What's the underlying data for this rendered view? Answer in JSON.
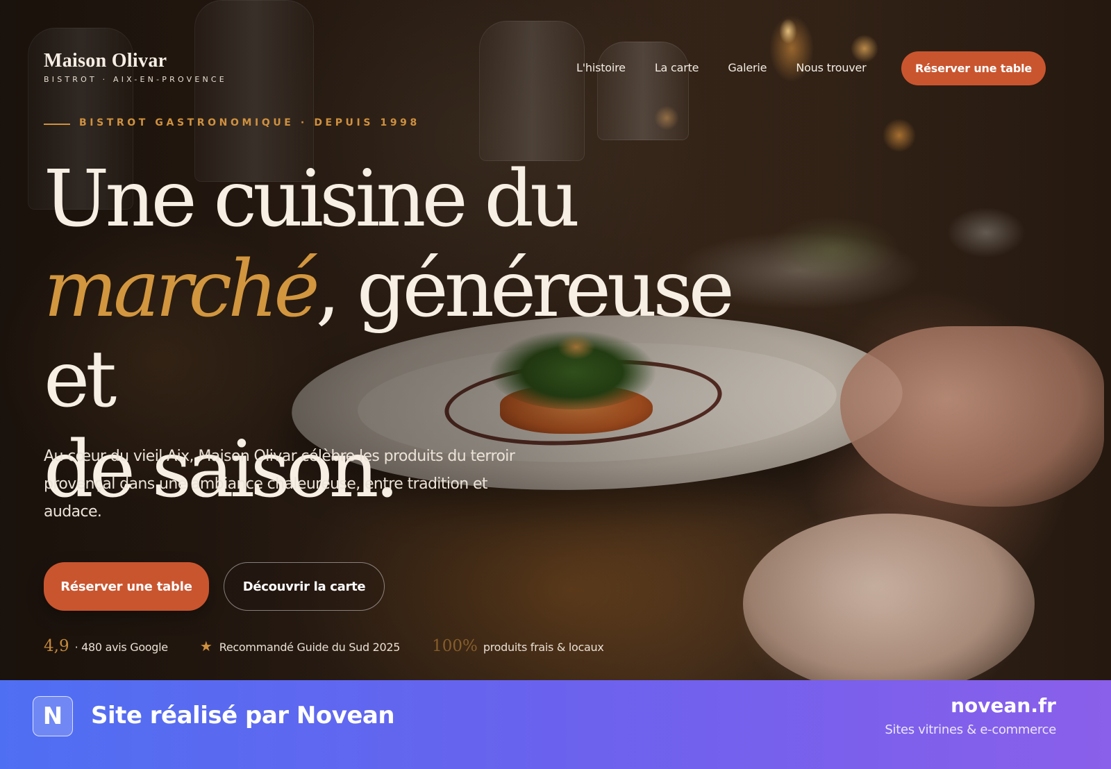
{
  "brand": {
    "name": "Maison Olivar",
    "tagline": "BISTROT · AIX-EN-PROVENCE"
  },
  "nav": {
    "items": [
      {
        "label": "L'histoire"
      },
      {
        "label": "La carte"
      },
      {
        "label": "Galerie"
      },
      {
        "label": "Nous trouver"
      }
    ],
    "cta_label": "Réserver une table"
  },
  "hero": {
    "eyebrow": "BISTROT GASTRONOMIQUE · DEPUIS 1998",
    "headline": {
      "part1": "Une cuisine du",
      "accent": "marché",
      "part2": ", généreuse et",
      "part3": "de saison."
    },
    "lede": "Au cœur du vieil Aix, Maison Olivar célèbre les produits du terroir provençal dans une ambiance chaleureuse, entre tradition et audace.",
    "primary_cta": "Réserver une table",
    "secondary_cta": "Découvrir la carte",
    "stats": [
      {
        "value": "4,9",
        "text": "· 480 avis Google"
      },
      {
        "icon": "star-icon",
        "text": "Recommandé Guide du Sud 2025"
      },
      {
        "value": "100%",
        "text": "produits frais & locaux"
      }
    ]
  },
  "banner": {
    "badge": "N",
    "title": "Site réalisé par Novean",
    "domain": "novean.fr",
    "subtitle": "Sites vitrines & e-commerce"
  },
  "colors": {
    "accent_orange": "#c9552f",
    "accent_gold": "#d0913f",
    "banner_start": "#4f6ff2",
    "banner_end": "#8a5fea"
  }
}
